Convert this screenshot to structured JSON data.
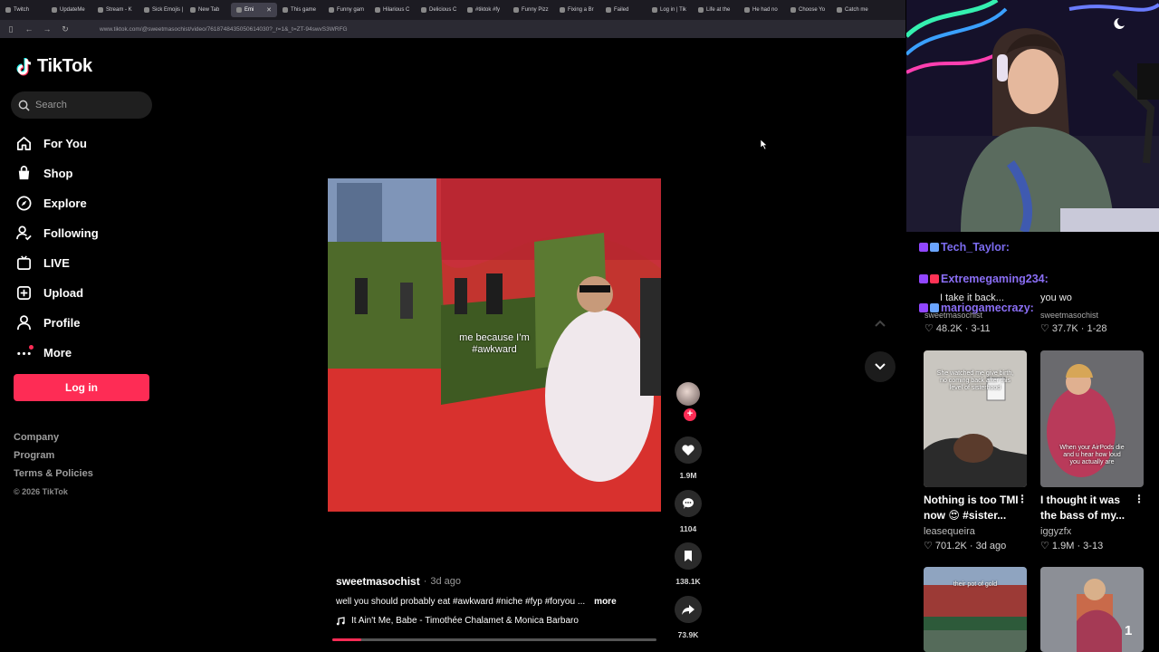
{
  "browser": {
    "tabs": [
      {
        "label": "Twitch",
        "active": false
      },
      {
        "label": "UpdateMe",
        "active": false
      },
      {
        "label": "Stream - K",
        "active": false
      },
      {
        "label": "Sick Emojis |",
        "active": false
      },
      {
        "label": "New Tab",
        "active": false
      },
      {
        "label": "Emi",
        "active": true
      },
      {
        "label": "This game",
        "active": false
      },
      {
        "label": "Funny gam",
        "active": false
      },
      {
        "label": "Hilarious C",
        "active": false
      },
      {
        "label": "Delicious C",
        "active": false
      },
      {
        "label": "#tiktok #fy",
        "active": false
      },
      {
        "label": "Funny Pizz",
        "active": false
      },
      {
        "label": "Fixing a Br",
        "active": false
      },
      {
        "label": "Failed",
        "active": false
      },
      {
        "label": "Log in | Tik",
        "active": false
      },
      {
        "label": "Life at the",
        "active": false
      },
      {
        "label": "He had no",
        "active": false
      },
      {
        "label": "Choose Yo",
        "active": false
      },
      {
        "label": "Catch me",
        "active": false
      }
    ],
    "url": "www.tiktok.com/@sweetmasochist/video/7618748435050614030?_r=1&_t=ZT-94swvS3WRFG"
  },
  "sidebar": {
    "logo_text": "TikTok",
    "search_placeholder": "Search",
    "nav": [
      {
        "label": "For You",
        "icon": "home-icon"
      },
      {
        "label": "Shop",
        "icon": "shopping-bag-icon"
      },
      {
        "label": "Explore",
        "icon": "compass-icon"
      },
      {
        "label": "Following",
        "icon": "following-icon"
      },
      {
        "label": "LIVE",
        "icon": "live-icon"
      },
      {
        "label": "Upload",
        "icon": "upload-icon"
      },
      {
        "label": "Profile",
        "icon": "profile-icon"
      },
      {
        "label": "More",
        "icon": "more-icon"
      }
    ],
    "login_label": "Log in",
    "footer": {
      "company": "Company",
      "program": "Program",
      "terms": "Terms & Policies",
      "copyright": "© 2026 TikTok"
    }
  },
  "video": {
    "overlay_caption_line1": "me because I’m",
    "overlay_caption_line2": "#awkward",
    "author": "sweetmasochist",
    "time_ago": "3d ago",
    "description": "well you should probably eat #awkward #niche #fyp #foryou ...",
    "more_label": "more",
    "music": "It Ain't Me, Babe - Timothée Chalamet & Monica Barbaro",
    "progress_fraction": 0.09,
    "likes": "1.9M",
    "comments": "1104",
    "saves": "138.1K",
    "shares": "73.9K"
  },
  "stream_overlay": {
    "chat": [
      {
        "user": "Tech_Taylor:",
        "color": "#7c6cf0"
      },
      {
        "user": "Extremegaming234:",
        "color": "#8a6ef5"
      },
      {
        "user": "mariogamecrazy:",
        "color": "#8a6ef5"
      }
    ],
    "chat_messages": [
      "I take it back...",
      "you wo"
    ],
    "emote_count": "1"
  },
  "recommendations": {
    "top_row_stats": [
      {
        "likes": "48.2K",
        "date": "3-11"
      },
      {
        "likes": "37.7K",
        "date": "1-28"
      }
    ],
    "top_row_authors": [
      "sweetmasochist",
      "sweetmasochist"
    ],
    "items": [
      {
        "title": "Nothing is too TMI now 😍 #sister...",
        "author": "leasequeira",
        "likes": "701.2K",
        "date": "3d ago",
        "thumb_caption": "She watched me give birth, no coming back after this level of sisterhood"
      },
      {
        "title": "I thought it was the bass of my...",
        "author": "iggyzfx",
        "likes": "1.9M",
        "date": "3-13",
        "thumb_caption": "When your AirPods die and u hear how loud you actually are"
      }
    ],
    "bottom_caption": "their pot of gold"
  }
}
